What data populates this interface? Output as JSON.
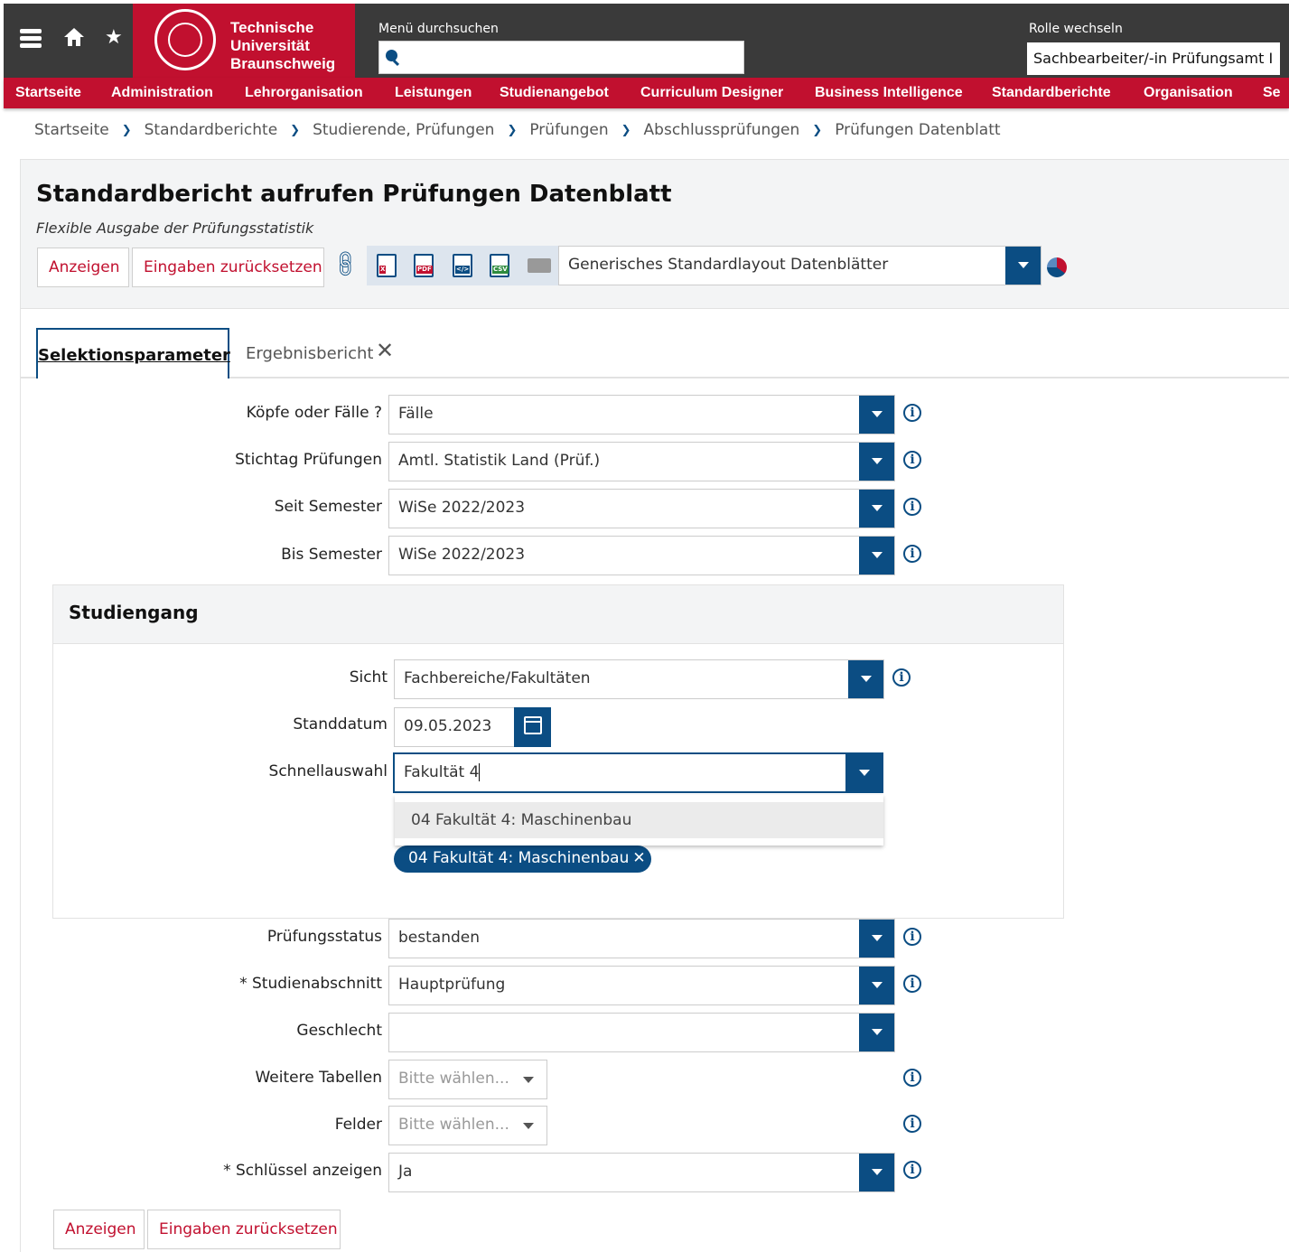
{
  "topbar": {
    "logo_line1": "Technische",
    "logo_line2": "Universität",
    "logo_line3": "Braunschweig",
    "menu_search_label": "Menü durchsuchen",
    "role_label": "Rolle wechseln",
    "role_value": "Sachbearbeiter/-in Prüfungsamt I",
    "icons": [
      "menu-icon",
      "home-icon",
      "star-icon",
      "search-icon"
    ]
  },
  "nav": [
    "Startseite",
    "Administration",
    "Lehrorganisation",
    "Leistungen",
    "Studienangebot",
    "Curriculum Designer",
    "Business Intelligence",
    "Standardberichte",
    "Organisation",
    "Se"
  ],
  "breadcrumb": [
    "Startseite",
    "Standardberichte",
    "Studierende, Prüfungen",
    "Prüfungen",
    "Abschlussprüfungen",
    "Prüfungen Datenblatt"
  ],
  "page": {
    "title": "Standardbericht aufrufen Prüfungen Datenblatt",
    "subtitle": "Flexible Ausgabe der Prüfungsstatistik",
    "btn_show": "Anzeigen",
    "btn_reset": "Eingaben zurücksetzen",
    "export_icons": [
      "xls",
      "pdf",
      "xml",
      "csv",
      "html"
    ],
    "layout_select": "Generisches Standardlayout Datenblätter"
  },
  "tabs": {
    "active": "Selektionsparameter",
    "second": "Ergebnisbericht",
    "close": "✕"
  },
  "form": {
    "koepfe_label": "Köpfe oder Fälle ?",
    "koepfe_value": "Fälle",
    "stichtag_label": "Stichtag Prüfungen",
    "stichtag_value": "Amtl. Statistik Land (Prüf.)",
    "seit_label": "Seit Semester",
    "seit_value": "WiSe 2022/2023",
    "bis_label": "Bis Semester",
    "bis_value": "WiSe 2022/2023",
    "pruefstatus_label": "Prüfungsstatus",
    "pruefstatus_value": "bestanden",
    "studienabschnitt_label": "* Studienabschnitt",
    "studienabschnitt_value": "Hauptprüfung",
    "geschlecht_label": "Geschlecht",
    "geschlecht_value": "",
    "weitere_label": "Weitere Tabellen",
    "weitere_placeholder": "Bitte wählen...",
    "felder_label": "Felder",
    "felder_placeholder": "Bitte wählen...",
    "schluessel_label": "* Schlüssel anzeigen",
    "schluessel_value": "Ja",
    "info": "i"
  },
  "studiengang": {
    "title": "Studiengang",
    "sicht_label": "Sicht",
    "sicht_value": "Fachbereiche/Fakultäten",
    "standdatum_label": "Standdatum",
    "standdatum_value": "09.05.2023",
    "schnell_label": "Schnellauswahl",
    "schnell_value": "Fakultät 4",
    "dropdown_option": "04 Fakultät 4: Maschinenbau",
    "chip": "04 Fakultät 4: Maschinenbau",
    "chip_close": "✕"
  },
  "footer": {
    "btn_show": "Anzeigen",
    "btn_reset": "Eingaben zurücksetzen"
  },
  "colors": {
    "brand_red": "#c1102f",
    "primary_blue": "#0b4d83",
    "topbar": "#3a3a3a"
  }
}
